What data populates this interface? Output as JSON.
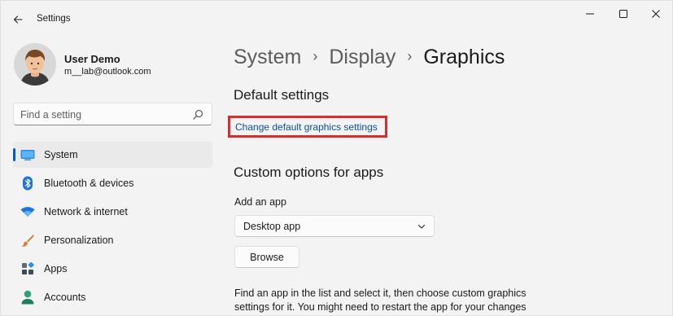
{
  "window": {
    "title": "Settings"
  },
  "user": {
    "name": "User Demo",
    "email": "m__lab@outlook.com"
  },
  "search": {
    "placeholder": "Find a setting"
  },
  "sidebar": {
    "items": [
      {
        "label": "System",
        "icon": "system-icon",
        "selected": true
      },
      {
        "label": "Bluetooth & devices",
        "icon": "bluetooth-icon",
        "selected": false
      },
      {
        "label": "Network & internet",
        "icon": "wifi-icon",
        "selected": false
      },
      {
        "label": "Personalization",
        "icon": "brush-icon",
        "selected": false
      },
      {
        "label": "Apps",
        "icon": "apps-icon",
        "selected": false
      },
      {
        "label": "Accounts",
        "icon": "person-icon",
        "selected": false
      }
    ]
  },
  "breadcrumb": {
    "items": [
      "System",
      "Display",
      "Graphics"
    ],
    "separator": "›"
  },
  "main": {
    "default_settings_title": "Default settings",
    "change_default_link": "Change default graphics settings",
    "custom_options_title": "Custom options for apps",
    "add_app_label": "Add an app",
    "app_type_selected": "Desktop app",
    "browse_label": "Browse",
    "help_text": "Find an app in the list and select it, then choose custom graphics settings for it. You might need to restart the app for your changes to take effect."
  },
  "colors": {
    "accent": "#005fb8",
    "highlight_box": "#d32f2f",
    "link": "#0a4f9c",
    "background": "#f3f3f3"
  }
}
